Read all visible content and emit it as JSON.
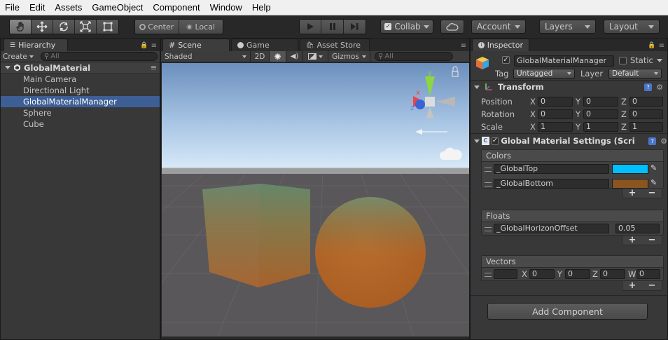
{
  "menu": [
    "File",
    "Edit",
    "Assets",
    "GameObject",
    "Component",
    "Window",
    "Help"
  ],
  "toolbar": {
    "transform_tools": [
      "hand-tool",
      "move-tool",
      "rotate-tool",
      "scale-tool",
      "rect-tool"
    ],
    "pivot": "Center",
    "space": "Local",
    "collab": "Collab",
    "account": "Account",
    "layers": "Layers",
    "layout": "Layout"
  },
  "hierarchy": {
    "tab": "Hierarchy",
    "create": "Create",
    "search_placeholder": "All",
    "scene_name": "GlobalMaterial",
    "items": [
      "Main Camera",
      "Directional Light",
      "GlobalMaterialManager",
      "Sphere",
      "Cube"
    ],
    "selected": "GlobalMaterialManager"
  },
  "scene": {
    "tabs": [
      "Scene",
      "Game",
      "Asset Store"
    ],
    "shading": "Shaded",
    "mode_2d": "2D",
    "gizmos": "Gizmos",
    "search_placeholder": "All",
    "gizmo_axes": {
      "y": "y",
      "x": "x",
      "z": "z"
    },
    "colors": {
      "sky_top": "#6a8fbf",
      "horizon": "#d7e9f7",
      "ground": "#585653",
      "cube": "#b46a2c",
      "sphere": "#c26c26"
    }
  },
  "inspector": {
    "tab": "Inspector",
    "object_name": "GlobalMaterialManager",
    "static": "Static",
    "tag_label": "Tag",
    "tag": "Untagged",
    "layer_label": "Layer",
    "layer": "Default",
    "transform": {
      "title": "Transform",
      "rows": [
        {
          "label": "Position",
          "x": "0",
          "y": "0",
          "z": "0"
        },
        {
          "label": "Rotation",
          "x": "0",
          "y": "0",
          "z": "0"
        },
        {
          "label": "Scale",
          "x": "1",
          "y": "1",
          "z": "1"
        }
      ],
      "axis_x": "X",
      "axis_y": "Y",
      "axis_z": "Z",
      "axis_w": "W"
    },
    "component": {
      "title": "Global Material Settings (Scri",
      "colors_header": "Colors",
      "colors": [
        {
          "name": "_GlobalTop",
          "color": "#00bfff"
        },
        {
          "name": "_GlobalBottom",
          "color": "#8a5520"
        }
      ],
      "floats_header": "Floats",
      "floats": [
        {
          "name": "_GlobalHorizonOffset",
          "value": "0.05"
        }
      ],
      "vectors_header": "Vectors",
      "vectors": [
        {
          "name": "",
          "x": "0",
          "y": "0",
          "z": "0",
          "w": "0"
        }
      ]
    },
    "add_component": "Add Component"
  }
}
